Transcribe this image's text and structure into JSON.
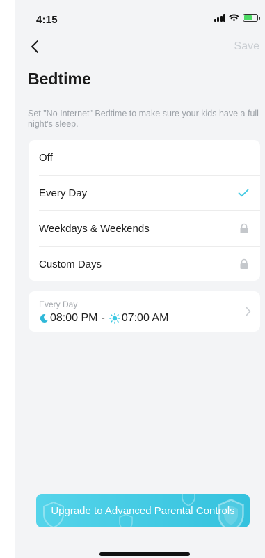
{
  "status_bar": {
    "time": "4:15"
  },
  "nav": {
    "save_label": "Save"
  },
  "page": {
    "title": "Bedtime",
    "description": "Set \"No Internet\" Bedtime to make sure your kids have a full night's sleep."
  },
  "options": [
    {
      "label": "Off",
      "state": "none"
    },
    {
      "label": "Every Day",
      "state": "selected"
    },
    {
      "label": "Weekdays & Weekends",
      "state": "locked"
    },
    {
      "label": "Custom Days",
      "state": "locked"
    }
  ],
  "schedule": {
    "label": "Every Day",
    "start_time": "08:00 PM",
    "separator": "-",
    "end_time": "07:00 AM"
  },
  "upgrade": {
    "label": "Upgrade to Advanced Parental Controls"
  },
  "colors": {
    "accent": "#3cc8e2",
    "check": "#3cc8e2",
    "disabled": "#c9cdd2",
    "card_bg": "#ffffff",
    "page_bg": "#f3f4f6"
  },
  "icons": [
    "back-icon",
    "signal-icon",
    "wifi-icon",
    "battery-icon",
    "check-icon",
    "lock-icon",
    "moon-icon",
    "sun-icon",
    "chevron-right-icon"
  ]
}
